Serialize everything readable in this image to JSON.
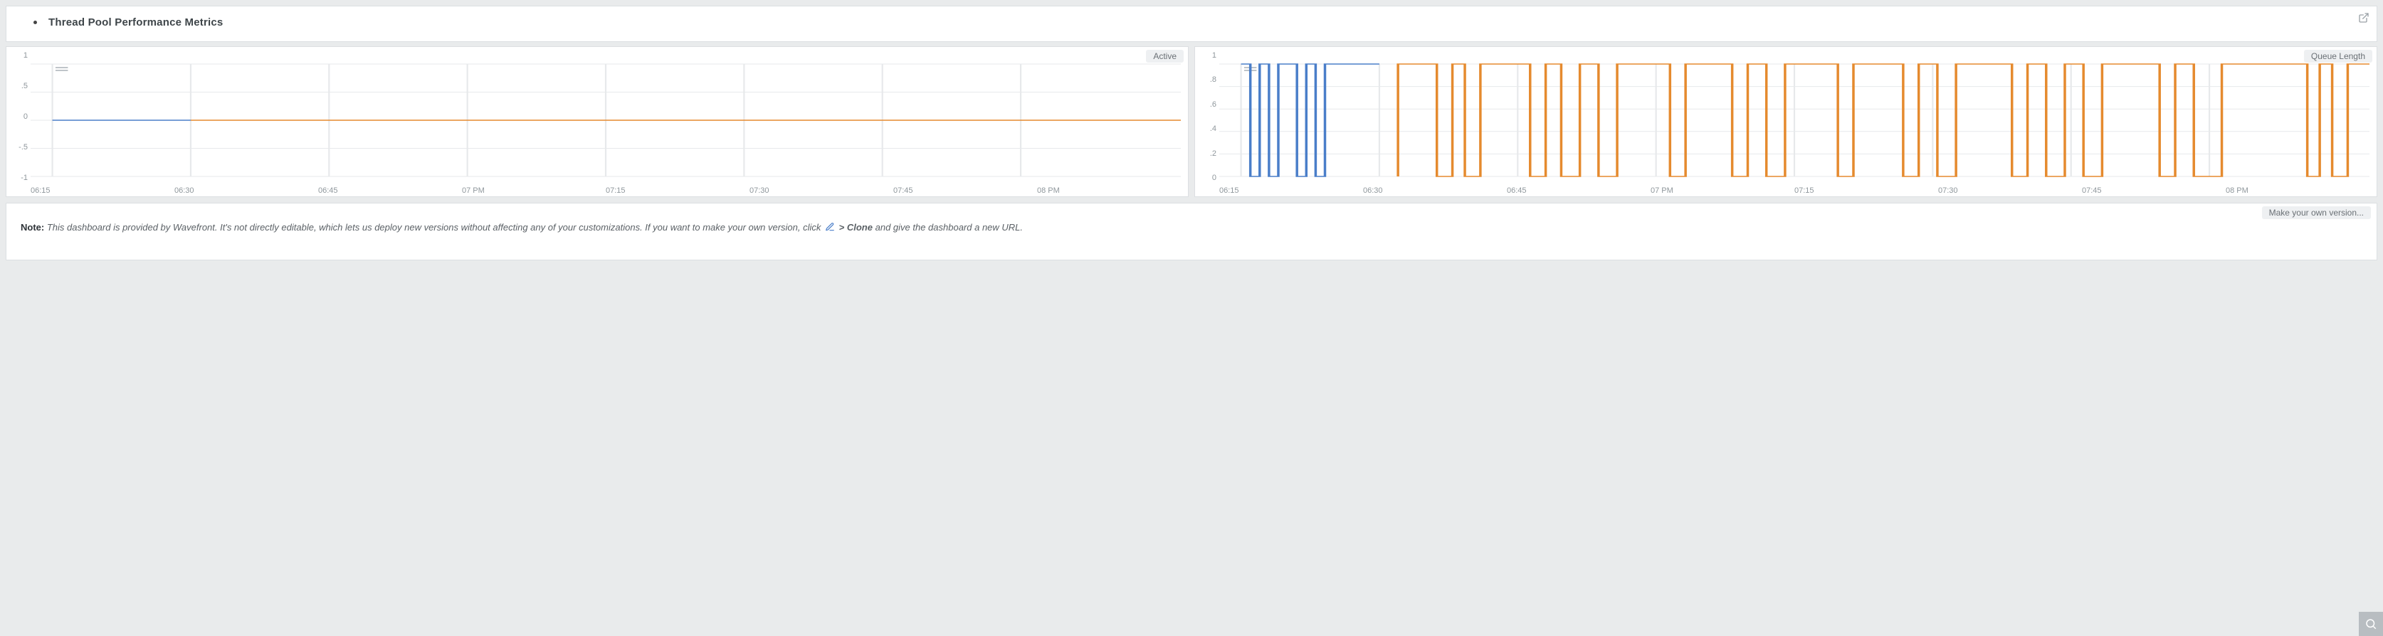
{
  "header": {
    "title": "Thread Pool Performance Metrics"
  },
  "charts": {
    "active": {
      "title": "Active",
      "yticks": [
        "1",
        ".5",
        "0",
        "-.5",
        "-1"
      ],
      "xticks": [
        "06:15",
        "06:30",
        "06:45",
        "07 PM",
        "07:15",
        "07:30",
        "07:45",
        "08 PM"
      ]
    },
    "queue": {
      "title": "Queue Length",
      "yticks": [
        "1",
        ".8",
        ".6",
        ".4",
        ".2",
        "0"
      ],
      "xticks": [
        "06:15",
        "06:30",
        "06:45",
        "07 PM",
        "07:15",
        "07:30",
        "07:45",
        "08 PM"
      ]
    }
  },
  "footer": {
    "make_own": "Make your own version...",
    "note_label": "Note:",
    "note_pre": "This dashboard is provided by Wavefront. It's not directly editable, which lets us deploy new versions without affecting any of your customizations. If you want to make your own version, click",
    "clone_prefix": "> ",
    "clone_word": "Clone",
    "note_post": "and give the dashboard a new URL."
  },
  "chart_data": [
    {
      "type": "line",
      "title": "Active",
      "xlabel": "",
      "ylabel": "",
      "ylim": [
        -1,
        1
      ],
      "x": [
        "06:15",
        "06:30",
        "06:45",
        "07:00 PM",
        "07:15",
        "07:30",
        "07:45",
        "08:00 PM"
      ],
      "series": [
        {
          "name": "blue",
          "values": [
            0,
            0,
            null,
            null,
            null,
            null,
            null,
            null
          ]
        },
        {
          "name": "orange",
          "values": [
            null,
            0,
            0,
            0,
            0,
            0,
            0,
            0
          ]
        }
      ]
    },
    {
      "type": "line",
      "title": "Queue Length",
      "xlabel": "",
      "ylabel": "",
      "ylim": [
        0,
        1
      ],
      "x": [
        "06:15",
        "06:16",
        "06:17",
        "06:18",
        "06:19",
        "06:20",
        "06:21",
        "06:22",
        "06:23",
        "06:24",
        "06:25",
        "06:26",
        "06:27",
        "06:28",
        "06:29",
        "06:30",
        "06:32",
        "06:34",
        "06:36",
        "06:38",
        "06:40",
        "06:42",
        "06:44",
        "06:46",
        "06:48",
        "06:50",
        "06:52",
        "06:54",
        "06:56",
        "06:58",
        "07:00 PM",
        "07:02",
        "07:04",
        "07:06",
        "07:08",
        "07:10",
        "07:12",
        "07:14",
        "07:16",
        "07:18",
        "07:20",
        "07:22",
        "07:24",
        "07:26",
        "07:28",
        "07:30",
        "07:32",
        "07:34",
        "07:36",
        "07:38",
        "07:40",
        "07:42",
        "07:44",
        "07:46",
        "07:48",
        "07:50",
        "07:52",
        "07:54",
        "07:56",
        "07:58",
        "08:00 PM",
        "08:02",
        "08:04",
        "08:06",
        "08:08",
        "08:10"
      ],
      "series": [
        {
          "name": "blue",
          "values": [
            1,
            1,
            0,
            1,
            0,
            1,
            1,
            0,
            1,
            0,
            1,
            1,
            1,
            1,
            1,
            1,
            null,
            null,
            null,
            null,
            null,
            null,
            null,
            null,
            null,
            null,
            null,
            null,
            null,
            null,
            null,
            null,
            null,
            null,
            null,
            null,
            null,
            null,
            null,
            null,
            null,
            null,
            null,
            null,
            null,
            null,
            null,
            null,
            null,
            null,
            null,
            null,
            null,
            null,
            null,
            null,
            null,
            null,
            null,
            null,
            null,
            null,
            null,
            null,
            null,
            null
          ]
        },
        {
          "name": "orange",
          "values": [
            null,
            null,
            null,
            null,
            null,
            null,
            null,
            null,
            null,
            null,
            null,
            null,
            null,
            null,
            null,
            null,
            0,
            1,
            1,
            0,
            1,
            0,
            1,
            1,
            0,
            1,
            0,
            1,
            0,
            1,
            1,
            0,
            1,
            1,
            0,
            1,
            0,
            1,
            1,
            0,
            1,
            1,
            0,
            1,
            0,
            1,
            1,
            0,
            1,
            0,
            1,
            0,
            1,
            1,
            1,
            1,
            0,
            1,
            0,
            1,
            1,
            1,
            0,
            1,
            0,
            1
          ]
        }
      ]
    }
  ]
}
